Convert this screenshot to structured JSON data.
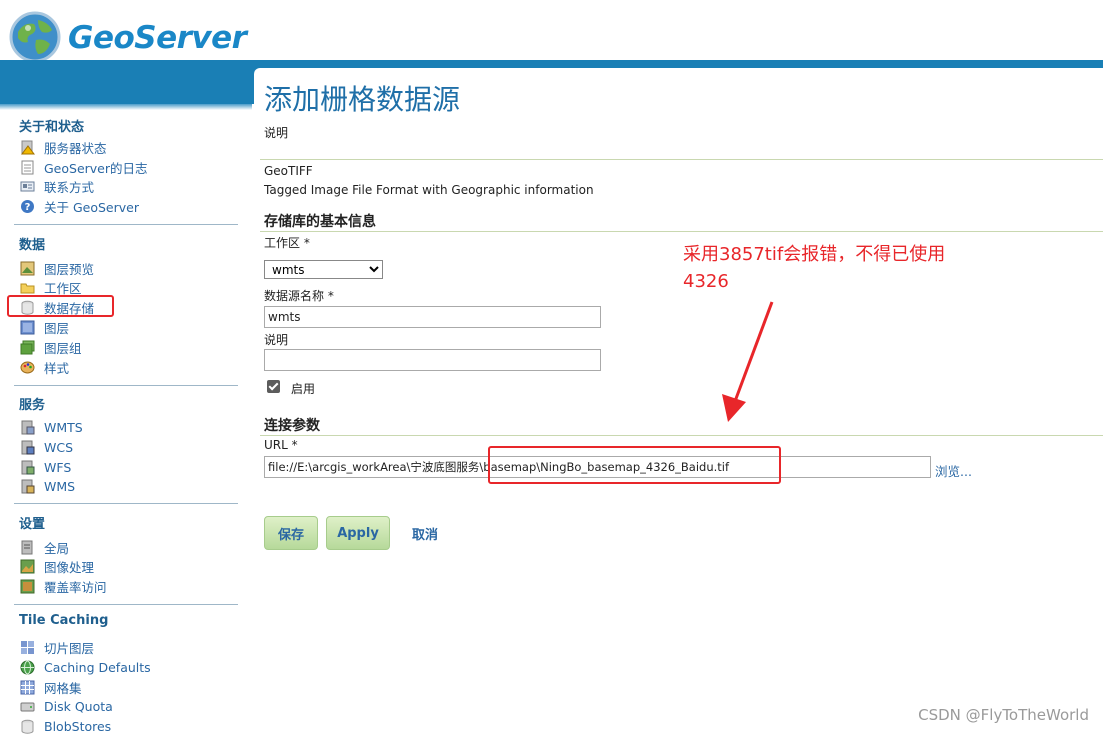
{
  "header": {
    "logo_text": "GeoServer"
  },
  "sidebar": {
    "sections": [
      {
        "title": "关于和状态",
        "items": [
          "服务器状态",
          "GeoServer的日志",
          "联系方式",
          "关于 GeoServer"
        ]
      },
      {
        "title": "数据",
        "items": [
          "图层预览",
          "工作区",
          "数据存储",
          "图层",
          "图层组",
          "样式"
        ]
      },
      {
        "title": "服务",
        "items": [
          "WMTS",
          "WCS",
          "WFS",
          "WMS"
        ]
      },
      {
        "title": "设置",
        "items": [
          "全局",
          "图像处理",
          "覆盖率访问"
        ]
      },
      {
        "title": "Tile Caching",
        "items": [
          "切片图层",
          "Caching Defaults",
          "网格集",
          "Disk Quota",
          "BlobStores"
        ]
      }
    ]
  },
  "main": {
    "title": "添加栅格数据源",
    "description_label": "说明",
    "format_name": "GeoTIFF",
    "format_description": "Tagged Image File Format with Geographic information",
    "basic_info_heading": "存储库的基本信息",
    "workspace_label": "工作区 *",
    "workspace_value": "wmts",
    "datasource_name_label": "数据源名称 *",
    "datasource_name_value": "wmts",
    "desc_field_label": "说明",
    "desc_field_value": "",
    "enabled_label": "启用",
    "connection_heading": "连接参数",
    "url_label": "URL *",
    "url_value": "file://E:\\arcgis_workArea\\宁波底图服务\\basemap\\NingBo_basemap_4326_Baidu.tif",
    "browse_label": "浏览...",
    "save_label": "保存",
    "apply_label": "Apply",
    "cancel_label": "取消"
  },
  "annotation": {
    "line1": "采用3857tif会报错，不得已使用",
    "line2": "4326",
    "color": "#e8262a"
  },
  "watermark": "CSDN @FlyToTheWorld"
}
